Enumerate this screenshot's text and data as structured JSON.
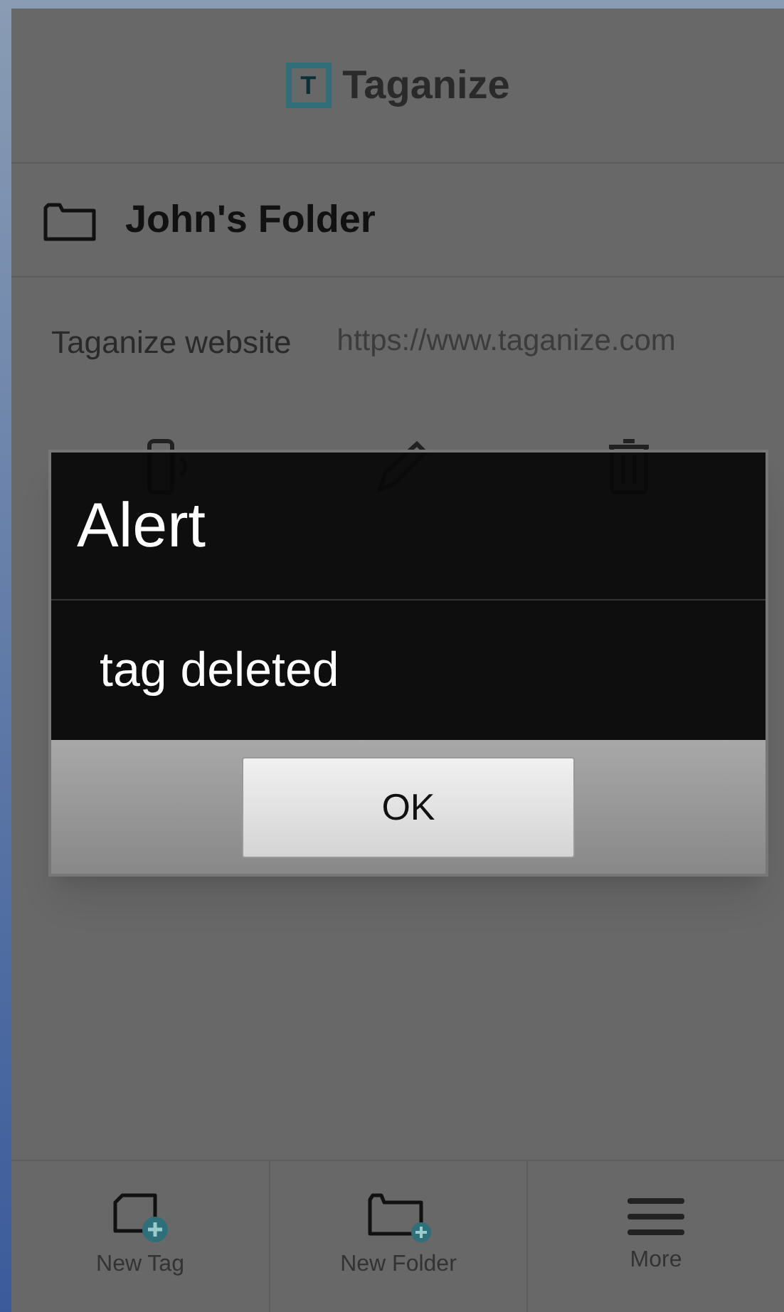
{
  "header": {
    "title": "Taganize",
    "logo_letter": "T"
  },
  "folder": {
    "name": "John's Folder"
  },
  "tags": [
    {
      "name": "Taganize website",
      "url": "https://www.taganize.com"
    }
  ],
  "dialog": {
    "title": "Alert",
    "message": "tag deleted",
    "buttons": [
      "OK"
    ]
  },
  "toolbar": [
    {
      "kind": "new-tag",
      "label": "New Tag"
    },
    {
      "kind": "new-folder",
      "label": "New Folder"
    },
    {
      "kind": "more",
      "label": "More"
    }
  ]
}
